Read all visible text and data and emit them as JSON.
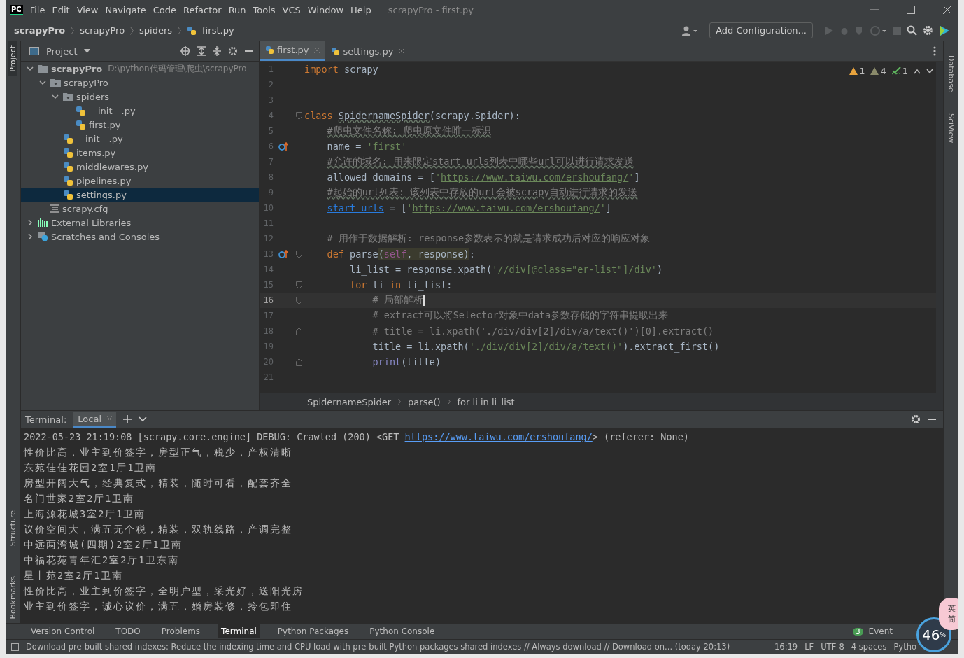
{
  "window": {
    "title": "scrapyPro - first.py"
  },
  "logo": "PC",
  "menu": [
    "File",
    "Edit",
    "View",
    "Navigate",
    "Code",
    "Refactor",
    "Run",
    "Tools",
    "VCS",
    "Window",
    "Help"
  ],
  "breadcrumb": [
    "scrapyPro",
    "scrapyPro",
    "spiders",
    "first.py"
  ],
  "toolbar": {
    "config_button": "Add Configuration..."
  },
  "project": {
    "title": "Project",
    "tree": [
      {
        "kind": "folder",
        "name": "scrapyPro",
        "path": "D:\\python代码管理\\爬虫\\scrapyPro",
        "expanded": true,
        "selected": false,
        "children": [
          {
            "kind": "pkg",
            "name": "scrapyPro",
            "expanded": true,
            "selected": false,
            "children": [
              {
                "kind": "pkg",
                "name": "spiders",
                "expanded": true,
                "selected": false,
                "children": [
                  {
                    "kind": "py",
                    "name": "__init__.py",
                    "selected": false
                  },
                  {
                    "kind": "py",
                    "name": "first.py",
                    "selected": false
                  }
                ]
              },
              {
                "kind": "py",
                "name": "__init__.py",
                "selected": false
              },
              {
                "kind": "py",
                "name": "items.py",
                "selected": false
              },
              {
                "kind": "py",
                "name": "middlewares.py",
                "selected": false
              },
              {
                "kind": "py",
                "name": "pipelines.py",
                "selected": false
              },
              {
                "kind": "py",
                "name": "settings.py",
                "selected": true
              }
            ]
          },
          {
            "kind": "cfg",
            "name": "scrapy.cfg",
            "selected": false
          }
        ]
      },
      {
        "kind": "lib",
        "name": "External Libraries",
        "expanded": false,
        "selected": false
      },
      {
        "kind": "scratch",
        "name": "Scratches and Consoles",
        "expanded": false,
        "selected": false
      }
    ]
  },
  "tabs": [
    {
      "label": "first.py",
      "selected": true
    },
    {
      "label": "settings.py",
      "selected": false
    }
  ],
  "inspections": {
    "warnings": "1",
    "weak_warnings": "4",
    "typos": "1"
  },
  "code": [
    {
      "num": "1",
      "current": false,
      "override": false,
      "fold_start": false,
      "fold_end": false,
      "tokens": [
        {
          "t": "import",
          "kind": "kw"
        },
        {
          "t": " scrapy",
          "kind": "plain"
        }
      ]
    },
    {
      "num": "2",
      "current": false,
      "override": false,
      "fold_start": false,
      "fold_end": false
    },
    {
      "num": "3",
      "current": false,
      "override": false,
      "fold_start": false,
      "fold_end": false
    },
    {
      "num": "4",
      "current": false,
      "override": false,
      "fold_start": true,
      "fold_end": false,
      "tokens": [
        {
          "t": "class ",
          "kind": "kw"
        },
        {
          "t": "SpidernameSpider",
          "kind": "wavy"
        },
        {
          "t": "(scrapy.Spider):",
          "kind": "plain"
        }
      ]
    },
    {
      "num": "5",
      "current": false,
      "override": false,
      "fold_start": false,
      "fold_end": false,
      "tokens": [
        {
          "t": "    #爬虫文件名称: 爬虫原文件唯一标识",
          "kind": "com-wavy"
        }
      ]
    },
    {
      "num": "6",
      "current": false,
      "override": true,
      "fold_start": false,
      "fold_end": false,
      "tokens": [
        {
          "t": "    name = ",
          "kind": "plain"
        },
        {
          "t": "'first'",
          "kind": "str"
        }
      ]
    },
    {
      "num": "7",
      "current": false,
      "override": false,
      "fold_start": false,
      "fold_end": false,
      "tokens": [
        {
          "t": "    #允许的域名: 用来限定start_urls列表中哪些url可以进行请求发送",
          "kind": "com-wavy"
        }
      ]
    },
    {
      "num": "8",
      "current": false,
      "override": false,
      "fold_start": false,
      "fold_end": false,
      "tokens": [
        {
          "t": "    allowed_domains = [",
          "kind": "plain"
        },
        {
          "t": "'",
          "kind": "str"
        },
        {
          "t": "https://www.taiwu.com/ershoufang/",
          "kind": "url"
        },
        {
          "t": "'",
          "kind": "str"
        },
        {
          "t": "]",
          "kind": "plain"
        }
      ]
    },
    {
      "num": "9",
      "current": false,
      "override": false,
      "fold_start": false,
      "fold_end": false,
      "tokens": [
        {
          "t": "    #起始的url列表: 该列表中存放的url会被scrapy自动进行请求的发送",
          "kind": "com-wavy"
        }
      ]
    },
    {
      "num": "10",
      "current": false,
      "override": false,
      "fold_start": false,
      "fold_end": false,
      "tokens": [
        {
          "t": "    start_urls",
          "kind": "ref"
        },
        {
          "t": " = [",
          "kind": "plain"
        },
        {
          "t": "'",
          "kind": "str"
        },
        {
          "t": "https://www.taiwu.com/ershoufang/",
          "kind": "url"
        },
        {
          "t": "'",
          "kind": "str"
        },
        {
          "t": "]",
          "kind": "plain"
        }
      ]
    },
    {
      "num": "11",
      "current": false,
      "override": false,
      "fold_start": false,
      "fold_end": false
    },
    {
      "num": "12",
      "current": false,
      "override": false,
      "fold_start": false,
      "fold_end": false,
      "tokens": [
        {
          "t": "    # 用作于数据解析: response参数表示的就是请求成功后对应的响应对象",
          "kind": "com"
        }
      ]
    },
    {
      "num": "13",
      "current": false,
      "override": true,
      "fold_start": true,
      "fold_end": false,
      "tokens": [
        {
          "t": "    def",
          "kind": "kw"
        },
        {
          "t": " parse",
          "kind": "plain"
        },
        {
          "t": "(",
          "kind": "hl"
        },
        {
          "t": "self",
          "kind": "hl-self"
        },
        {
          "t": ", response)",
          "kind": "hl"
        },
        {
          "t": ":",
          "kind": "plain"
        }
      ]
    },
    {
      "num": "14",
      "current": false,
      "override": false,
      "fold_start": false,
      "fold_end": false,
      "tokens": [
        {
          "t": "        li_list = response.xpath(",
          "kind": "plain"
        },
        {
          "t": "'//div[@class=\"er-list\"]/div'",
          "kind": "str"
        },
        {
          "t": ")",
          "kind": "plain"
        }
      ]
    },
    {
      "num": "15",
      "current": false,
      "override": false,
      "fold_start": true,
      "fold_end": false,
      "tokens": [
        {
          "t": "        for",
          "kind": "kw"
        },
        {
          "t": " li ",
          "kind": "plain"
        },
        {
          "t": "in",
          "kind": "kw"
        },
        {
          "t": " li_list:",
          "kind": "plain"
        }
      ]
    },
    {
      "num": "16",
      "current": true,
      "override": false,
      "fold_start": true,
      "fold_end": false,
      "tokens": [
        {
          "t": "            # 局部解析",
          "kind": "com"
        }
      ]
    },
    {
      "num": "17",
      "current": false,
      "override": false,
      "fold_start": false,
      "fold_end": false,
      "tokens": [
        {
          "t": "            # extract可以将Selector对象中data参数存储的字符串提取出来",
          "kind": "com"
        }
      ]
    },
    {
      "num": "18",
      "current": false,
      "override": false,
      "fold_start": false,
      "fold_end": true,
      "tokens": [
        {
          "t": "            # title = li.xpath('./div/div[2]/div/a/text()')[0].extract()",
          "kind": "com"
        }
      ]
    },
    {
      "num": "19",
      "current": false,
      "override": false,
      "fold_start": false,
      "fold_end": false,
      "tokens": [
        {
          "t": "            title = li.xpath(",
          "kind": "plain"
        },
        {
          "t": "'./div/div[2]/div/a/text()'",
          "kind": "str"
        },
        {
          "t": ").extract_first()",
          "kind": "plain"
        }
      ]
    },
    {
      "num": "20",
      "current": false,
      "override": false,
      "fold_start": false,
      "fold_end": true,
      "tokens": [
        {
          "t": "            print",
          "kind": "builtin"
        },
        {
          "t": "(title)",
          "kind": "plain"
        }
      ]
    },
    {
      "num": "21",
      "current": false,
      "override": false,
      "fold_start": false,
      "fold_end": false
    }
  ],
  "editor_breadcrumb": [
    "SpidernameSpider",
    "parse()",
    "for li in li_list"
  ],
  "right_strip": [
    "Database",
    "SciView"
  ],
  "left_strip": [
    {
      "label": "Project",
      "selected": true
    },
    {
      "label": "Structure",
      "selected": false
    },
    {
      "label": "Bookmarks",
      "selected": false
    }
  ],
  "terminal": {
    "label": "Terminal:",
    "tabs": [
      {
        "label": "Local",
        "selected": true
      }
    ],
    "first_line": {
      "before": "2022-05-23 21:19:08 [scrapy.core.engine] DEBUG: Crawled (200) <GET ",
      "link": "https://www.taiwu.com/ershoufang/",
      "after": "> (referer: None)"
    },
    "lines": [
      "性价比高，业主到价签字，房型正气，税少，产权清晰",
      "东苑佳佳花园2室1厅1卫南",
      "房型开阔大气，经典复式，精装，随时可看，配套齐全",
      "名门世家2室2厅1卫南",
      "上海源花城3室2厅1卫南",
      "议价空间大，满五无个税，精装，双轨线路，产调完整",
      "中远两湾城(四期)2室2厅1卫南",
      "中福花苑青年汇2室2厅1卫东南",
      "星丰苑2室2厅1卫南",
      "性价比高，业主到价签字，全明户型，采光好，送阳光房",
      "业主到价签字，诚心议价，满五，婚房装修，拎包即住"
    ]
  },
  "tool_tabs": [
    {
      "label": "Version Control",
      "selected": false
    },
    {
      "label": "TODO",
      "selected": false
    },
    {
      "label": "Problems",
      "selected": false
    },
    {
      "label": "Terminal",
      "selected": true
    },
    {
      "label": "Python Packages",
      "selected": false
    },
    {
      "label": "Python Console",
      "selected": false
    }
  ],
  "event_log": {
    "count": "3",
    "label": "Event"
  },
  "status_bar": {
    "message": "Download pre-built shared indexes: Reduce the indexing time and CPU load with pre-built Python packages shared indexes // Always download // Download on... (today 20:13)",
    "position": "16:19",
    "line_sep": "LF",
    "encoding": "UTF-8",
    "indent": "4 spaces",
    "interpreter": "Pytho"
  },
  "overlay": {
    "gauge": "46",
    "unit": "%",
    "ime": [
      "英",
      "简"
    ]
  }
}
